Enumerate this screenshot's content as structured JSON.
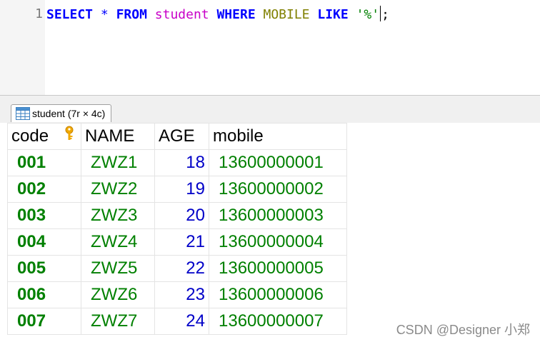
{
  "editor": {
    "line_number": "1",
    "tokens": {
      "select": "SELECT",
      "star": "*",
      "from": "FROM",
      "table": "student",
      "where": "WHERE",
      "column": "MOBILE",
      "like": "LIKE",
      "pattern": "'%'",
      "terminator": ";"
    }
  },
  "tab": {
    "label": "student (7r × 4c)",
    "icon": "table-grid-icon"
  },
  "grid": {
    "columns": [
      "code",
      "NAME",
      "AGE",
      "mobile"
    ],
    "key_icon": "primary-key-icon",
    "rows": [
      {
        "code": "001",
        "name": "ZWZ1",
        "age": "18",
        "mobile": "13600000001"
      },
      {
        "code": "002",
        "name": "ZWZ2",
        "age": "19",
        "mobile": "13600000002"
      },
      {
        "code": "003",
        "name": "ZWZ3",
        "age": "20",
        "mobile": "13600000003"
      },
      {
        "code": "004",
        "name": "ZWZ4",
        "age": "21",
        "mobile": "13600000004"
      },
      {
        "code": "005",
        "name": "ZWZ5",
        "age": "22",
        "mobile": "13600000005"
      },
      {
        "code": "006",
        "name": "ZWZ6",
        "age": "23",
        "mobile": "13600000006"
      },
      {
        "code": "007",
        "name": "ZWZ7",
        "age": "24",
        "mobile": "13600000007"
      }
    ]
  },
  "watermark": "CSDN @Designer 小郑",
  "colors": {
    "keyword": "#0000ff",
    "table_name": "#c800c8",
    "column_name": "#808000",
    "string": "#008000",
    "text_value": "#008000",
    "number_value": "#0000c8"
  }
}
